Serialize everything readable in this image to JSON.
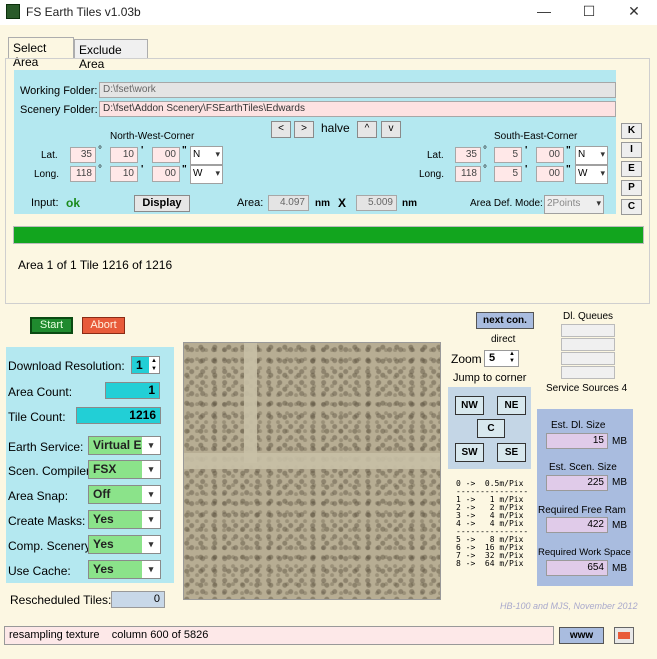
{
  "window": {
    "title": "FS Earth Tiles   v1.03b",
    "min": "—",
    "max": "☐",
    "close": "✕"
  },
  "tabs": [
    {
      "label": "Select Area"
    },
    {
      "label": "Exclude Area"
    }
  ],
  "folders": {
    "working_label": "Working Folder:",
    "working_value": "D:\\fset\\work",
    "scenery_label": "Scenery Folder:",
    "scenery_value": "D:\\fset\\Addon Scenery\\FSEarthTiles\\Edwards"
  },
  "nav": {
    "left": "<",
    "right": ">",
    "halve": "halve",
    "up": "^",
    "down": "v"
  },
  "nw": {
    "title": "North-West-Corner",
    "lat_label": "Lat.",
    "long_label": "Long.",
    "lat_deg": "35",
    "lat_min": "10",
    "lat_sec": "00",
    "lat_dir": "N",
    "lon_deg": "118",
    "lon_min": "10",
    "lon_sec": "00",
    "lon_dir": "W"
  },
  "se": {
    "title": "South-East-Corner",
    "lat_label": "Lat.",
    "long_label": "Long.",
    "lat_deg": "35",
    "lat_min": "5",
    "lat_sec": "00",
    "lat_dir": "N",
    "lon_deg": "118",
    "lon_min": "5",
    "lon_sec": "00",
    "lon_dir": "W"
  },
  "symbols": {
    "deg": "°",
    "min": "'",
    "sec": "\""
  },
  "kiepc": [
    "K",
    "I",
    "E",
    "P",
    "C"
  ],
  "input": {
    "label": "Input:",
    "status": "ok",
    "display_button": "Display",
    "area_label": "Area:",
    "area_w": "4.097",
    "unit1": "nm",
    "x": "X",
    "area_h": "5.009",
    "unit2": "nm",
    "mode_label": "Area Def. Mode:",
    "mode_value": "2Points"
  },
  "progress": {
    "area_text": "Area 1 of 1   Tile 1216 of 1216",
    "fraction": 1.0
  },
  "start": "Start",
  "abort": "Abort",
  "left": {
    "resolution_label": "Download Resolution:",
    "resolution_value": "1",
    "area_count_label": "Area Count:",
    "area_count": "1",
    "tile_count_label": "Tile Count:",
    "tile_count": "1216",
    "earth_service_label": "Earth Service:",
    "earth_service": "Virtual Ea",
    "scen_compiler_label": "Scen. Compiler:",
    "scen_compiler": "FSX",
    "area_snap_label": "Area Snap:",
    "area_snap": "Off",
    "create_masks_label": "Create Masks:",
    "create_masks": "Yes",
    "comp_scenery_label": "Comp. Scenery:",
    "comp_scenery": "Yes",
    "use_cache_label": "Use Cache:",
    "use_cache": "Yes",
    "rescheduled_label": "Rescheduled Tiles:",
    "rescheduled": "0"
  },
  "mid": {
    "next_con": "next con.",
    "direct": "direct",
    "zoom_label": "Zoom",
    "zoom_value": "5",
    "jump_label": "Jump to corner",
    "nw": "NW",
    "ne": "NE",
    "c": "C",
    "sw": "SW",
    "se": "SE",
    "zoom_table": "0 ->  0.5m/Pix\n---------------\n1 ->   1 m/Pix\n2 ->   2 m/Pix\n3 ->   4 m/Pix\n4 ->   4 m/Pix\n---------------\n5 ->   8 m/Pix\n6 ->  16 m/Pix\n7 ->  32 m/Pix\n8 ->  64 m/Pix"
  },
  "right": {
    "dl_queues": "Dl. Queues",
    "service_sources": "Service Sources 4",
    "est_dl_label": "Est. Dl. Size",
    "est_dl": "15",
    "est_scen_label": "Est. Scen. Size",
    "est_scen": "225",
    "ram_label": "Required Free Ram",
    "ram": "422",
    "work_label": "Required Work Space",
    "work": "654",
    "mb": "MB"
  },
  "credit": "HB-100 and MJS, November 2012",
  "status": "resampling texture    column 600 of 5826",
  "www": "www",
  "colors": {
    "start": "#1f8a2e",
    "abort": "#e85b3a",
    "progress": "#12a51e",
    "credit": "#a9a9cc"
  }
}
